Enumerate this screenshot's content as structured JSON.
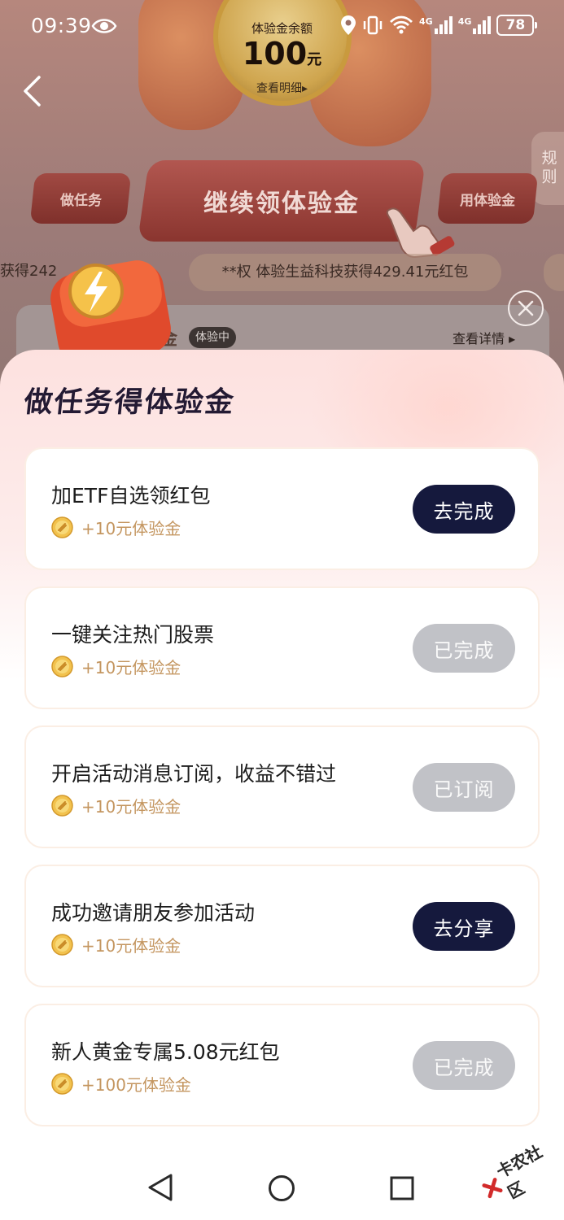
{
  "status_bar": {
    "time": "09:39",
    "network_1": "4G",
    "network_2": "4G",
    "battery": "78"
  },
  "background_page": {
    "balance_label": "体验金余额",
    "balance_amount": "100",
    "balance_unit": "元",
    "balance_detail": "查看明细▸",
    "rules_tab": "规则",
    "tasks_button": "做任务",
    "main_button": "继续领体验金",
    "use_button": "用体验金",
    "ticker_left": "获得242",
    "ticker_main": "**权 体验生益科技获得429.41元红包",
    "peek_title": "金",
    "peek_badge": "体验中",
    "peek_detail": "查看详情 ▸"
  },
  "sheet": {
    "title": "做任务得体验金",
    "tasks": [
      {
        "title": "加ETF自选领红包",
        "reward": "+10元体验金",
        "button": "去完成",
        "state": "active"
      },
      {
        "title": "一键关注热门股票",
        "reward": "+10元体验金",
        "button": "已完成",
        "state": "done"
      },
      {
        "title": "开启活动消息订阅，收益不错过",
        "reward": "+10元体验金",
        "button": "已订阅",
        "state": "done"
      },
      {
        "title": "成功邀请朋友参加活动",
        "reward": "+10元体验金",
        "button": "去分享",
        "state": "active"
      },
      {
        "title": "新人黄金专属5.08元红包",
        "reward": "+100元体验金",
        "button": "已完成",
        "state": "done"
      }
    ]
  },
  "watermark": "卡农社区",
  "colors": {
    "active_button": "#15193d",
    "done_button": "#c1c2c7",
    "reward_text": "#c49660",
    "title_text": "#231a33"
  }
}
